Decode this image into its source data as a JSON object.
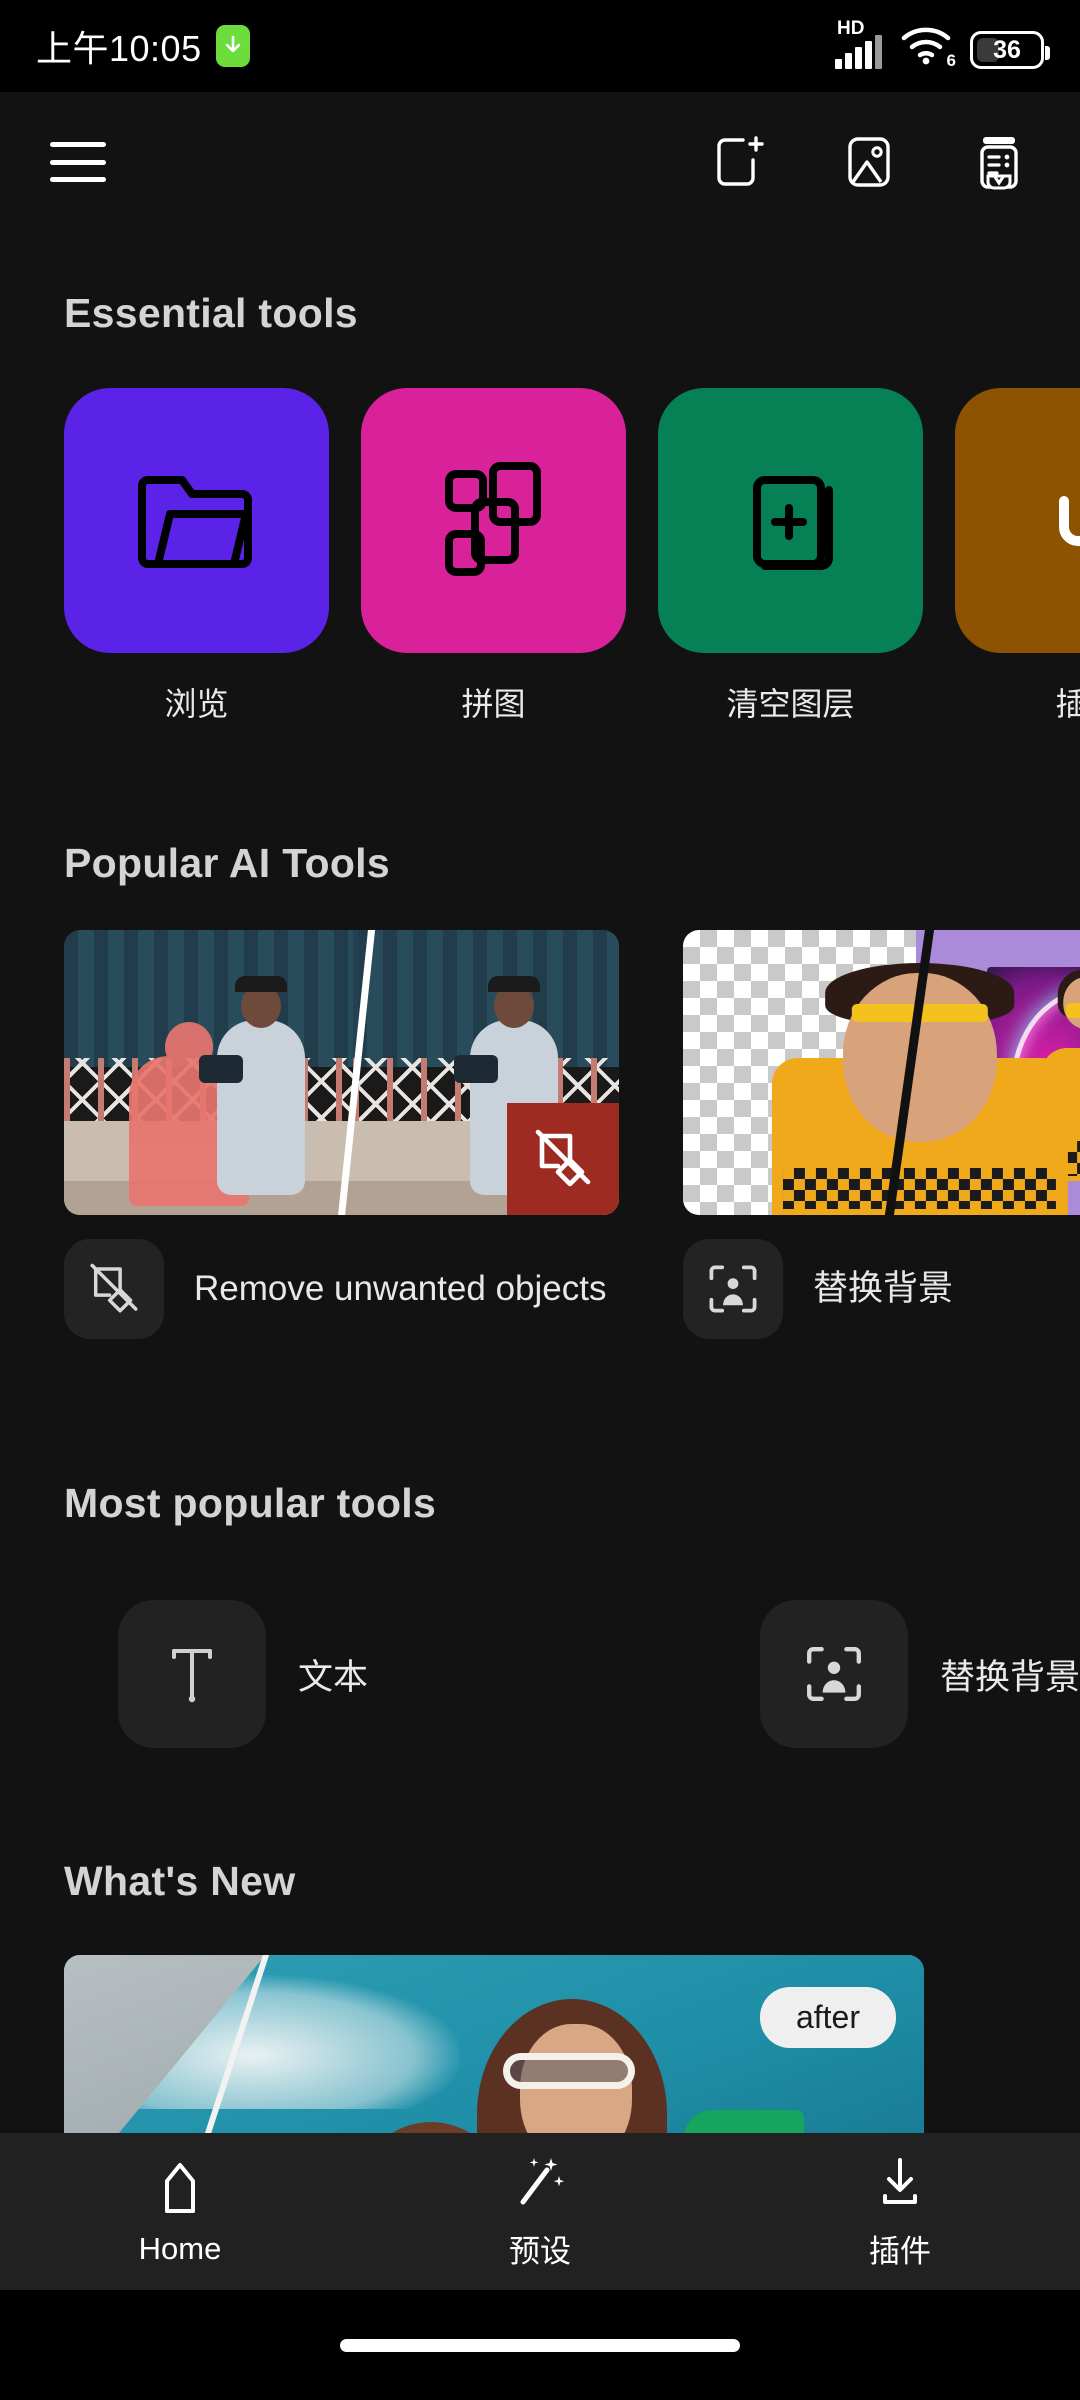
{
  "status_bar": {
    "time": "上午10:05",
    "download_icon": "download-arrow-icon",
    "network_label": "HD",
    "wifi_generation": "6",
    "battery_percent": "36"
  },
  "app_bar": {
    "menu_icon": "hamburger-menu-icon",
    "actions": [
      {
        "name": "new-project-icon",
        "label": "New project"
      },
      {
        "name": "open-image-icon",
        "label": "Open image"
      },
      {
        "name": "projects-archive-icon",
        "label": "Projects"
      }
    ]
  },
  "sections": {
    "essential": {
      "title": "Essential tools"
    },
    "ai": {
      "title": "Popular AI Tools"
    },
    "most_popular": {
      "title": "Most popular tools"
    },
    "whats_new": {
      "title": "What's New"
    }
  },
  "essential_tools": [
    {
      "label": "浏览",
      "color": "#5B22E8",
      "icon": "folder-icon"
    },
    {
      "label": "拼图",
      "color": "#D92299",
      "icon": "collage-icon"
    },
    {
      "label": "清空图层",
      "color": "#068055",
      "icon": "add-layer-icon"
    },
    {
      "label": "插件",
      "color": "#8E5203",
      "icon": "plugin-icon"
    }
  ],
  "ai_tools": [
    {
      "label": "Remove unwanted objects",
      "icon": "remove-object-icon",
      "thumb": "before-after-street-photo"
    },
    {
      "label": "替换背景",
      "icon": "replace-background-icon",
      "thumb": "cutout-neon-portrait"
    }
  ],
  "most_popular_tools": [
    {
      "label": "文本",
      "icon": "text-tool-icon"
    },
    {
      "label": "替换背景",
      "icon": "replace-background-icon"
    }
  ],
  "whats_new": {
    "badge": "after",
    "image": "before-after-sky-portrait"
  },
  "bottom_nav": [
    {
      "label": "Home",
      "icon": "home-icon",
      "active": true
    },
    {
      "label": "预设",
      "icon": "magic-wand-icon",
      "active": false
    },
    {
      "label": "插件",
      "icon": "download-icon",
      "active": false
    }
  ],
  "colors": {
    "background": "#121212",
    "nav_background": "#212121",
    "text_primary": "#EAEAEA",
    "chip_background": "#232323"
  }
}
